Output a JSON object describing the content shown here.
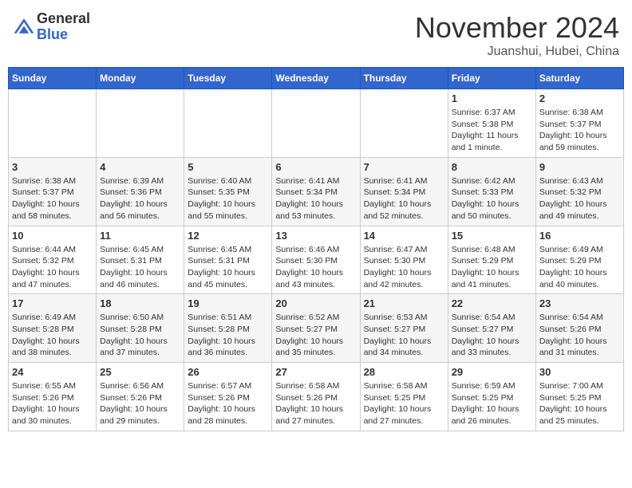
{
  "header": {
    "logo_general": "General",
    "logo_blue": "Blue",
    "month_title": "November 2024",
    "location": "Juanshui, Hubei, China"
  },
  "days_of_week": [
    "Sunday",
    "Monday",
    "Tuesday",
    "Wednesday",
    "Thursday",
    "Friday",
    "Saturday"
  ],
  "weeks": [
    [
      {
        "day": "",
        "info": ""
      },
      {
        "day": "",
        "info": ""
      },
      {
        "day": "",
        "info": ""
      },
      {
        "day": "",
        "info": ""
      },
      {
        "day": "",
        "info": ""
      },
      {
        "day": "1",
        "info": "Sunrise: 6:37 AM\nSunset: 5:38 PM\nDaylight: 11 hours and 1 minute."
      },
      {
        "day": "2",
        "info": "Sunrise: 6:38 AM\nSunset: 5:37 PM\nDaylight: 10 hours and 59 minutes."
      }
    ],
    [
      {
        "day": "3",
        "info": "Sunrise: 6:38 AM\nSunset: 5:37 PM\nDaylight: 10 hours and 58 minutes."
      },
      {
        "day": "4",
        "info": "Sunrise: 6:39 AM\nSunset: 5:36 PM\nDaylight: 10 hours and 56 minutes."
      },
      {
        "day": "5",
        "info": "Sunrise: 6:40 AM\nSunset: 5:35 PM\nDaylight: 10 hours and 55 minutes."
      },
      {
        "day": "6",
        "info": "Sunrise: 6:41 AM\nSunset: 5:34 PM\nDaylight: 10 hours and 53 minutes."
      },
      {
        "day": "7",
        "info": "Sunrise: 6:41 AM\nSunset: 5:34 PM\nDaylight: 10 hours and 52 minutes."
      },
      {
        "day": "8",
        "info": "Sunrise: 6:42 AM\nSunset: 5:33 PM\nDaylight: 10 hours and 50 minutes."
      },
      {
        "day": "9",
        "info": "Sunrise: 6:43 AM\nSunset: 5:32 PM\nDaylight: 10 hours and 49 minutes."
      }
    ],
    [
      {
        "day": "10",
        "info": "Sunrise: 6:44 AM\nSunset: 5:32 PM\nDaylight: 10 hours and 47 minutes."
      },
      {
        "day": "11",
        "info": "Sunrise: 6:45 AM\nSunset: 5:31 PM\nDaylight: 10 hours and 46 minutes."
      },
      {
        "day": "12",
        "info": "Sunrise: 6:45 AM\nSunset: 5:31 PM\nDaylight: 10 hours and 45 minutes."
      },
      {
        "day": "13",
        "info": "Sunrise: 6:46 AM\nSunset: 5:30 PM\nDaylight: 10 hours and 43 minutes."
      },
      {
        "day": "14",
        "info": "Sunrise: 6:47 AM\nSunset: 5:30 PM\nDaylight: 10 hours and 42 minutes."
      },
      {
        "day": "15",
        "info": "Sunrise: 6:48 AM\nSunset: 5:29 PM\nDaylight: 10 hours and 41 minutes."
      },
      {
        "day": "16",
        "info": "Sunrise: 6:49 AM\nSunset: 5:29 PM\nDaylight: 10 hours and 40 minutes."
      }
    ],
    [
      {
        "day": "17",
        "info": "Sunrise: 6:49 AM\nSunset: 5:28 PM\nDaylight: 10 hours and 38 minutes."
      },
      {
        "day": "18",
        "info": "Sunrise: 6:50 AM\nSunset: 5:28 PM\nDaylight: 10 hours and 37 minutes."
      },
      {
        "day": "19",
        "info": "Sunrise: 6:51 AM\nSunset: 5:28 PM\nDaylight: 10 hours and 36 minutes."
      },
      {
        "day": "20",
        "info": "Sunrise: 6:52 AM\nSunset: 5:27 PM\nDaylight: 10 hours and 35 minutes."
      },
      {
        "day": "21",
        "info": "Sunrise: 6:53 AM\nSunset: 5:27 PM\nDaylight: 10 hours and 34 minutes."
      },
      {
        "day": "22",
        "info": "Sunrise: 6:54 AM\nSunset: 5:27 PM\nDaylight: 10 hours and 33 minutes."
      },
      {
        "day": "23",
        "info": "Sunrise: 6:54 AM\nSunset: 5:26 PM\nDaylight: 10 hours and 31 minutes."
      }
    ],
    [
      {
        "day": "24",
        "info": "Sunrise: 6:55 AM\nSunset: 5:26 PM\nDaylight: 10 hours and 30 minutes."
      },
      {
        "day": "25",
        "info": "Sunrise: 6:56 AM\nSunset: 5:26 PM\nDaylight: 10 hours and 29 minutes."
      },
      {
        "day": "26",
        "info": "Sunrise: 6:57 AM\nSunset: 5:26 PM\nDaylight: 10 hours and 28 minutes."
      },
      {
        "day": "27",
        "info": "Sunrise: 6:58 AM\nSunset: 5:26 PM\nDaylight: 10 hours and 27 minutes."
      },
      {
        "day": "28",
        "info": "Sunrise: 6:58 AM\nSunset: 5:25 PM\nDaylight: 10 hours and 27 minutes."
      },
      {
        "day": "29",
        "info": "Sunrise: 6:59 AM\nSunset: 5:25 PM\nDaylight: 10 hours and 26 minutes."
      },
      {
        "day": "30",
        "info": "Sunrise: 7:00 AM\nSunset: 5:25 PM\nDaylight: 10 hours and 25 minutes."
      }
    ]
  ]
}
